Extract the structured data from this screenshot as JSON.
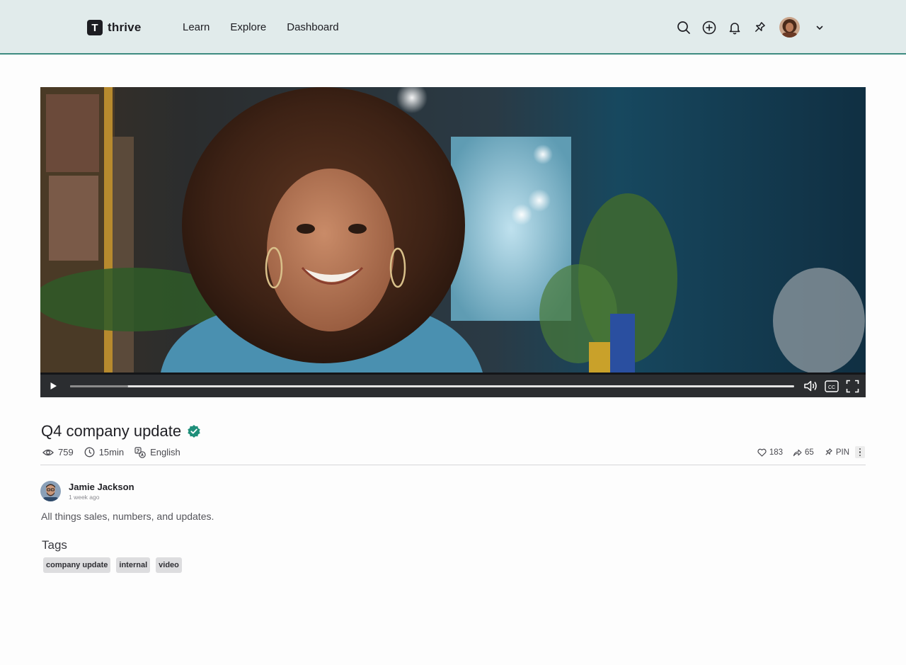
{
  "header": {
    "logo_letter": "T",
    "logo_text": "thrive",
    "nav": [
      {
        "label": "Learn"
      },
      {
        "label": "Explore"
      },
      {
        "label": "Dashboard"
      }
    ],
    "icons": [
      "search-icon",
      "add-icon",
      "bell-icon",
      "pin-icon",
      "user-avatar",
      "chevron-down-icon"
    ],
    "border_color": "#3e8b80",
    "background": "#e1ebeb"
  },
  "video": {
    "controls": [
      "play-icon",
      "progress-bar",
      "volume-icon",
      "captions-icon",
      "fullscreen-icon"
    ],
    "captions_label": "CC",
    "progress_buffered_fraction": 0.08,
    "progress_played_fraction": 0.0
  },
  "post": {
    "title": "Q4 company update",
    "verified": true,
    "views": "759",
    "duration": "15min",
    "language": "English",
    "likes": "183",
    "shares": "65",
    "pin_label": "PIN"
  },
  "author": {
    "name": "Jamie Jackson",
    "time": "1 week ago"
  },
  "description": "All things sales, numbers, and updates.",
  "tags": {
    "heading": "Tags",
    "items": [
      "company update",
      "internal",
      "video"
    ]
  },
  "colors": {
    "accent": "#1f8f7a",
    "text": "#1f1f24"
  }
}
